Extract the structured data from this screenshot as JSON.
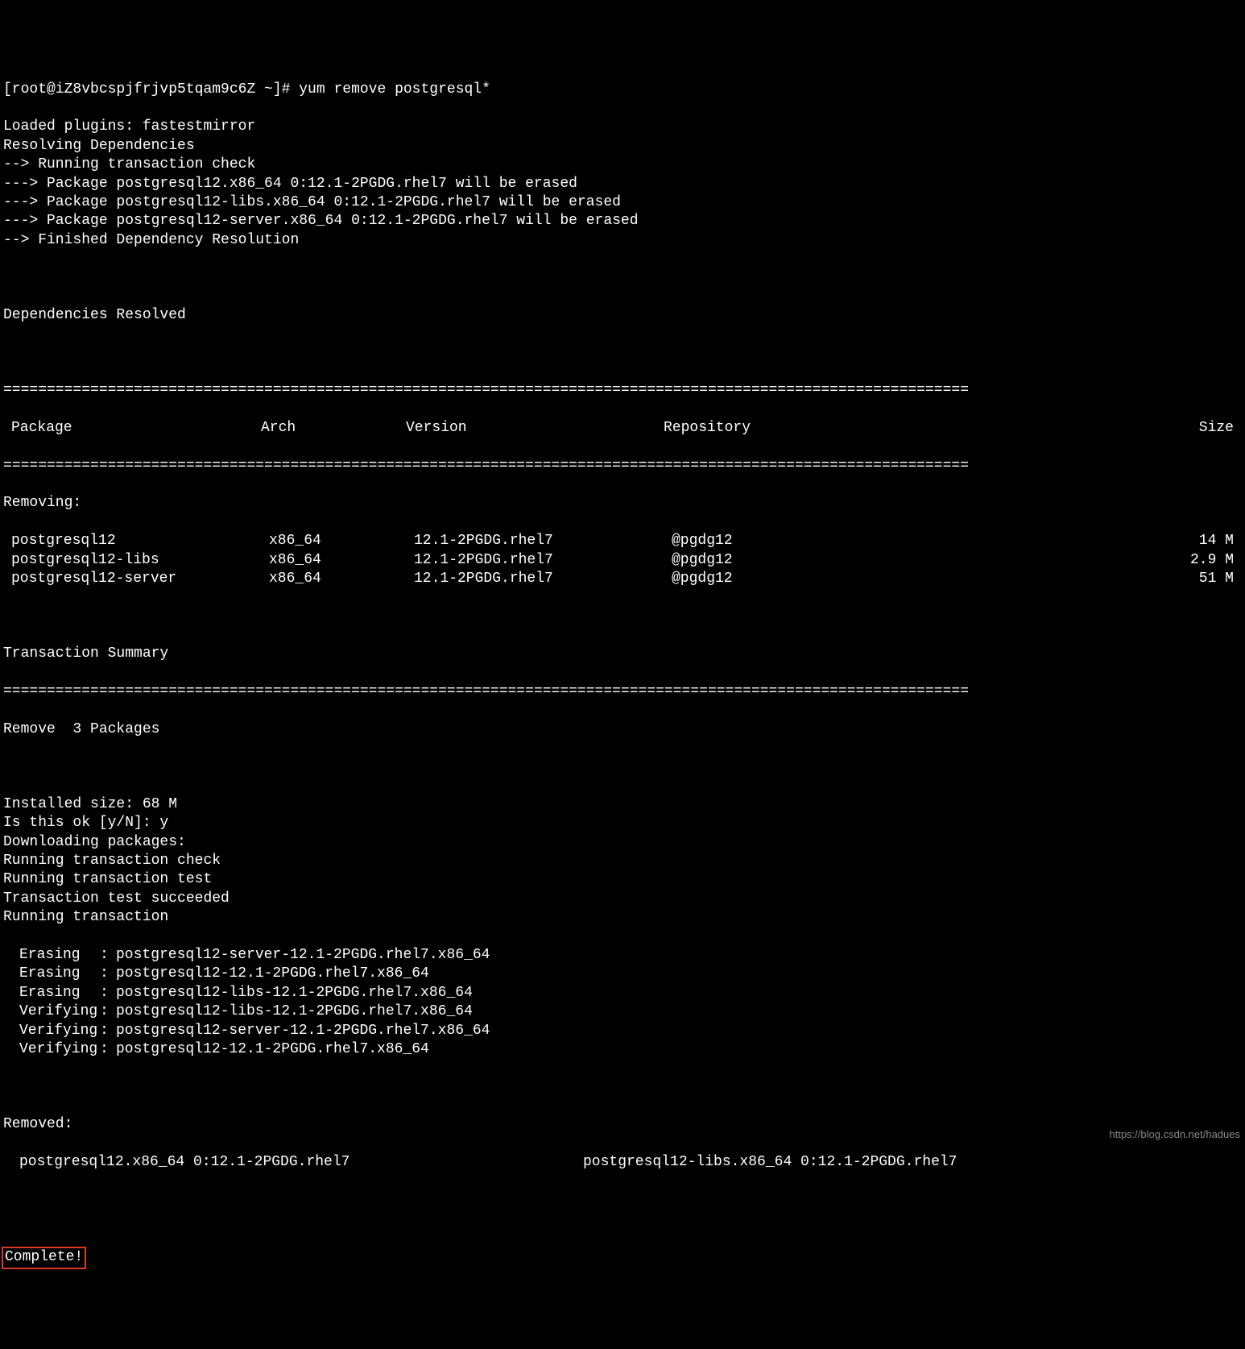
{
  "prompt": "[root@iZ8vbcspjfrjvp5tqam9c6Z ~]# yum remove postgresql*",
  "header_lines": [
    "Loaded plugins: fastestmirror",
    "Resolving Dependencies",
    "--> Running transaction check",
    "---> Package postgresql12.x86_64 0:12.1-2PGDG.rhel7 will be erased",
    "---> Package postgresql12-libs.x86_64 0:12.1-2PGDG.rhel7 will be erased",
    "---> Package postgresql12-server.x86_64 0:12.1-2PGDG.rhel7 will be erased",
    "--> Finished Dependency Resolution"
  ],
  "deps_resolved": "Dependencies Resolved",
  "divider": "===============================================================================================================",
  "table_headers": {
    "package": "Package",
    "arch": "Arch",
    "version": "Version",
    "repo": "Repository",
    "size": "Size"
  },
  "removing_label": "Removing:",
  "packages": [
    {
      "name": "postgresql12",
      "arch": "x86_64",
      "version": "12.1-2PGDG.rhel7",
      "repo": "@pgdg12",
      "size": "14 M"
    },
    {
      "name": "postgresql12-libs",
      "arch": "x86_64",
      "version": "12.1-2PGDG.rhel7",
      "repo": "@pgdg12",
      "size": "2.9 M"
    },
    {
      "name": "postgresql12-server",
      "arch": "x86_64",
      "version": "12.1-2PGDG.rhel7",
      "repo": "@pgdg12",
      "size": "51 M"
    }
  ],
  "transaction_summary": "Transaction Summary",
  "remove_count": "Remove  3 Packages",
  "mid_lines": [
    "Installed size: 68 M",
    "Is this ok [y/N]: y",
    "Downloading packages:",
    "Running transaction check",
    "Running transaction test",
    "Transaction test succeeded",
    "Running transaction"
  ],
  "transactions": [
    {
      "action": "Erasing",
      "pkg": "postgresql12-server-12.1-2PGDG.rhel7.x86_64"
    },
    {
      "action": "Erasing",
      "pkg": "postgresql12-12.1-2PGDG.rhel7.x86_64"
    },
    {
      "action": "Erasing",
      "pkg": "postgresql12-libs-12.1-2PGDG.rhel7.x86_64"
    },
    {
      "action": "Verifying",
      "pkg": "postgresql12-libs-12.1-2PGDG.rhel7.x86_64"
    },
    {
      "action": "Verifying",
      "pkg": "postgresql12-server-12.1-2PGDG.rhel7.x86_64"
    },
    {
      "action": "Verifying",
      "pkg": "postgresql12-12.1-2PGDG.rhel7.x86_64"
    }
  ],
  "removed_label": "Removed:",
  "removed_left": "postgresql12.x86_64 0:12.1-2PGDG.rhel7",
  "removed_right": "postgresql12-libs.x86_64 0:12.1-2PGDG.rhel7",
  "complete": "Complete!",
  "watermark": "https://blog.csdn.net/hadues"
}
